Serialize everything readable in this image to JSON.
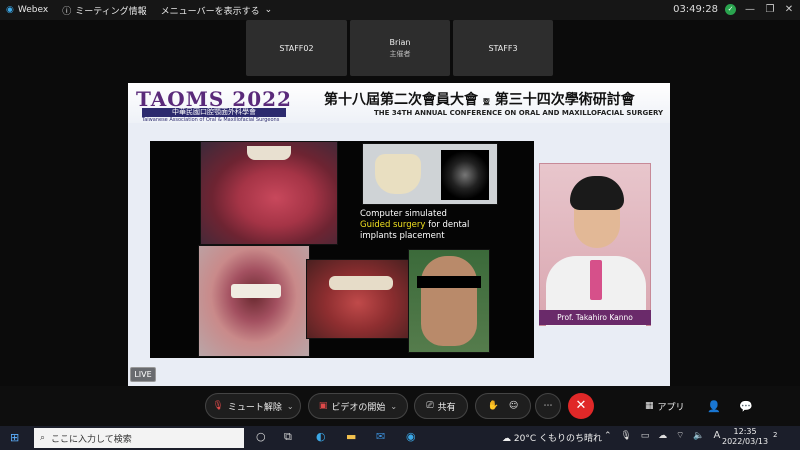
{
  "titlebar": {
    "app_name": "Webex",
    "meeting_info": "ミーティング情報",
    "show_menu": "メニューバーを表示する",
    "clock": "03:49:28"
  },
  "participants": [
    {
      "name": "STAFF02",
      "role": ""
    },
    {
      "name": "Brian",
      "role": "主催者"
    },
    {
      "name": "STAFF3",
      "role": ""
    }
  ],
  "slide": {
    "logo": "TAOMS 2022",
    "org_cn": "中華民國口腔顎面外科學會",
    "org_en": "Taiwanese Association of Oral & Maxillofacial Surgeons",
    "conf_cn_a": "第十八屆第二次會員大會",
    "conf_and": "暨",
    "conf_cn_b": "第三十四次學術研討會",
    "conf_en": "THE 34TH ANNUAL CONFERENCE ON ORAL AND MAXILLOFACIAL SURGERY",
    "caption_line1": "Computer simulated",
    "caption_hl": "Guided surgery",
    "caption_line2_rest": " for dental",
    "caption_line3": "implants placement",
    "speaker": "Prof. Takahiro Kanno",
    "live": "LIVE"
  },
  "controls": {
    "mute": "ミュート解除",
    "video": "ビデオの開始",
    "share": "共有",
    "apps": "アプリ"
  },
  "taskbar": {
    "search_placeholder": "ここに入力して検索",
    "weather": "20°C くもりのち晴れ",
    "ime": "A",
    "time": "12:35",
    "date": "2022/03/13",
    "notifications": "2"
  }
}
